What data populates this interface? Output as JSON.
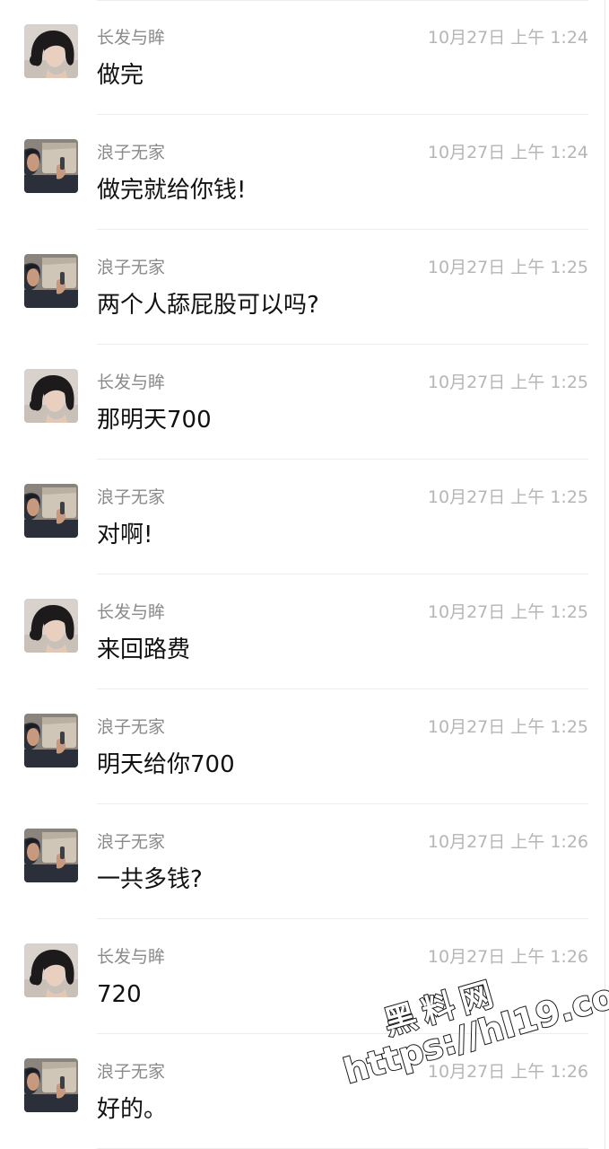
{
  "avatars": {
    "female": {
      "icon": "long-hair-woman-avatar",
      "colors": {
        "bg": "#d9d2cc",
        "hair": "#1c1a1a",
        "skin": "#e8cfc0"
      }
    },
    "male": {
      "icon": "man-in-car-avatar",
      "colors": {
        "bg": "#8a847c",
        "panel": "#cfc6b8",
        "dark": "#2a2f3a",
        "skin": "#c79a7e"
      }
    }
  },
  "messages": [
    {
      "sender": "长发与眸",
      "avatar": "female",
      "time": "10月27日 上午 1:24",
      "text": "做完"
    },
    {
      "sender": "浪子无家",
      "avatar": "male",
      "time": "10月27日 上午 1:24",
      "text": "做完就给你钱!"
    },
    {
      "sender": "浪子无家",
      "avatar": "male",
      "time": "10月27日 上午 1:25",
      "text": "两个人舔屁股可以吗?"
    },
    {
      "sender": "长发与眸",
      "avatar": "female",
      "time": "10月27日 上午 1:25",
      "text": "那明天700"
    },
    {
      "sender": "浪子无家",
      "avatar": "male",
      "time": "10月27日 上午 1:25",
      "text": "对啊!"
    },
    {
      "sender": "长发与眸",
      "avatar": "female",
      "time": "10月27日 上午 1:25",
      "text": "来回路费"
    },
    {
      "sender": "浪子无家",
      "avatar": "male",
      "time": "10月27日 上午 1:25",
      "text": "明天给你700"
    },
    {
      "sender": "浪子无家",
      "avatar": "male",
      "time": "10月27日 上午 1:26",
      "text": "一共多钱?"
    },
    {
      "sender": "长发与眸",
      "avatar": "female",
      "time": "10月27日 上午 1:26",
      "text": "720"
    },
    {
      "sender": "浪子无家",
      "avatar": "male",
      "time": "10月27日 上午 1:26",
      "text": "好的。"
    }
  ],
  "watermark": {
    "title": "黑料网",
    "url": "https://hl19.co"
  }
}
